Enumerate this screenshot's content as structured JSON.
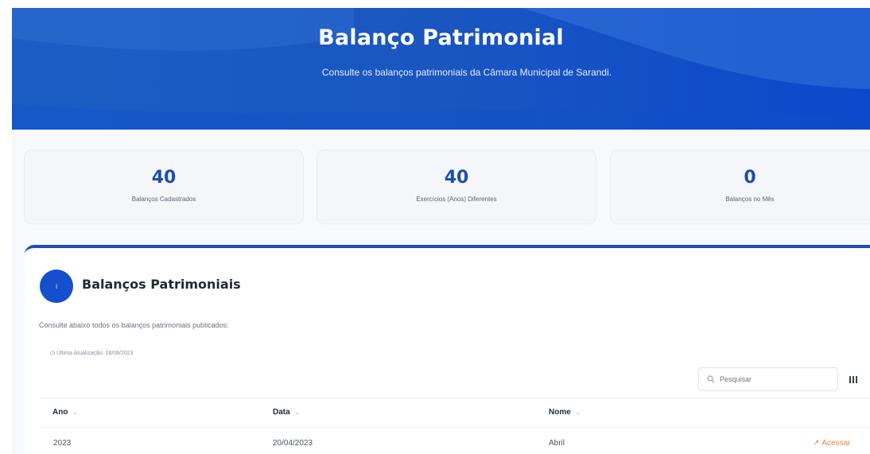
{
  "header": {
    "title": "Balanço Patrimonial",
    "subtitle": "Consulte os balanços patrimoniais da Câmara Municipal de Sarandi."
  },
  "stats": [
    {
      "value": "40",
      "label": "Balanços Cadastrados"
    },
    {
      "value": "40",
      "label": "Exercícios (Anos) Diferentes"
    },
    {
      "value": "0",
      "label": "Balanços no Mês"
    }
  ],
  "panel": {
    "badge": "i",
    "title": "Balanços Patrimoniais",
    "description": "Consulte abaixo todos os balanços patrimoniais publicados:",
    "updated": "Última Atualização: 18/08/2023"
  },
  "search": {
    "placeholder": "Pesquisar",
    "icon": "search-icon"
  },
  "table": {
    "columns": [
      {
        "label": "Ano",
        "sort": "⌄"
      },
      {
        "label": "Data",
        "sort": "⌄"
      },
      {
        "label": "Nome",
        "sort": "⌄"
      }
    ],
    "rows": [
      {
        "ano": "2023",
        "data": "20/04/2023",
        "nome": "Abril",
        "action": "Acessar"
      }
    ]
  },
  "colors": {
    "primary": "#1450cc",
    "accent": "#e08a3c",
    "stat_value": "#1d4eb1"
  }
}
